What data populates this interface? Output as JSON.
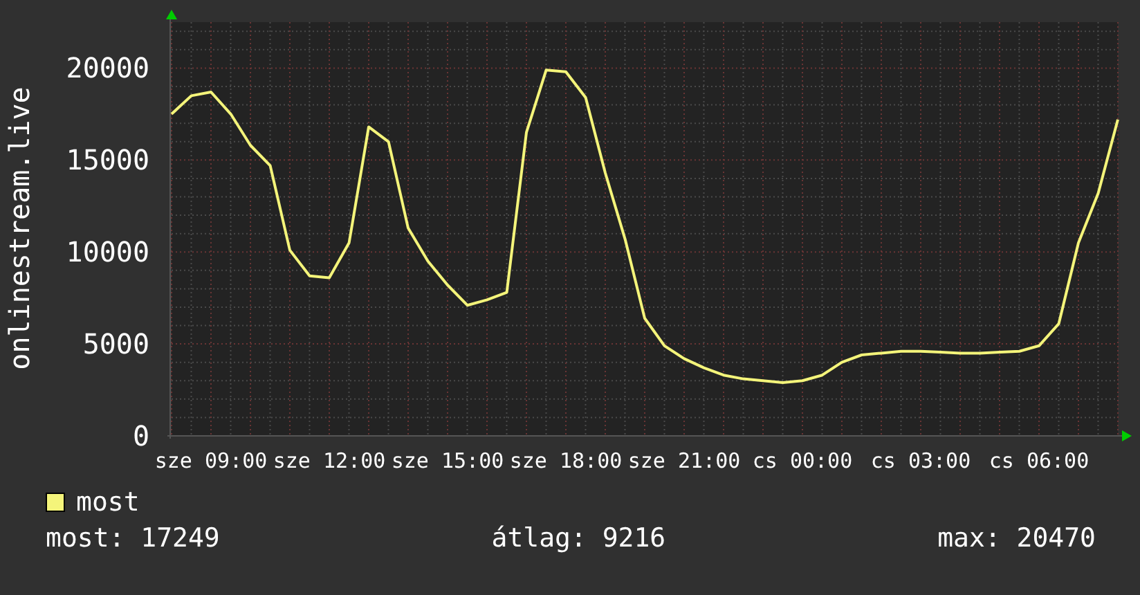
{
  "chart": {
    "chart_data": {
      "type": "line",
      "ylabel": "onlinestream.live",
      "categories": [
        null,
        null,
        "sze 09:00",
        null,
        null,
        null,
        null,
        null,
        "sze 12:00",
        null,
        null,
        null,
        null,
        null,
        "sze 15:00",
        null,
        null,
        null,
        null,
        null,
        "sze 18:00",
        null,
        null,
        null,
        null,
        null,
        "sze 21:00",
        null,
        null,
        null,
        null,
        null,
        "cs 00:00",
        null,
        null,
        null,
        null,
        null,
        "cs 03:00",
        null,
        null,
        null,
        null,
        null,
        "cs 06:00",
        null,
        null,
        null,
        null
      ],
      "series": [
        {
          "name": "most",
          "color": "#f4f47a",
          "values": [
            17500,
            18500,
            18700,
            17500,
            15800,
            14700,
            10100,
            8700,
            8600,
            10500,
            16800,
            16000,
            11300,
            9500,
            8200,
            7100,
            7400,
            7800,
            16500,
            19900,
            19800,
            18400,
            14300,
            10700,
            6400,
            4900,
            4200,
            3700,
            3300,
            3100,
            3000,
            2900,
            3000,
            3300,
            4000,
            4400,
            4500,
            4600,
            4600,
            4550,
            4500,
            4500,
            4550,
            4600,
            4900,
            6100,
            10500,
            13200,
            17200
          ]
        }
      ],
      "grid": true,
      "ylim": [
        0,
        22500
      ],
      "yticks": [
        0,
        5000,
        10000,
        15000,
        20000
      ]
    }
  },
  "stats": [
    "most: 17249",
    "átlag: 9216",
    "max: 20470"
  ]
}
